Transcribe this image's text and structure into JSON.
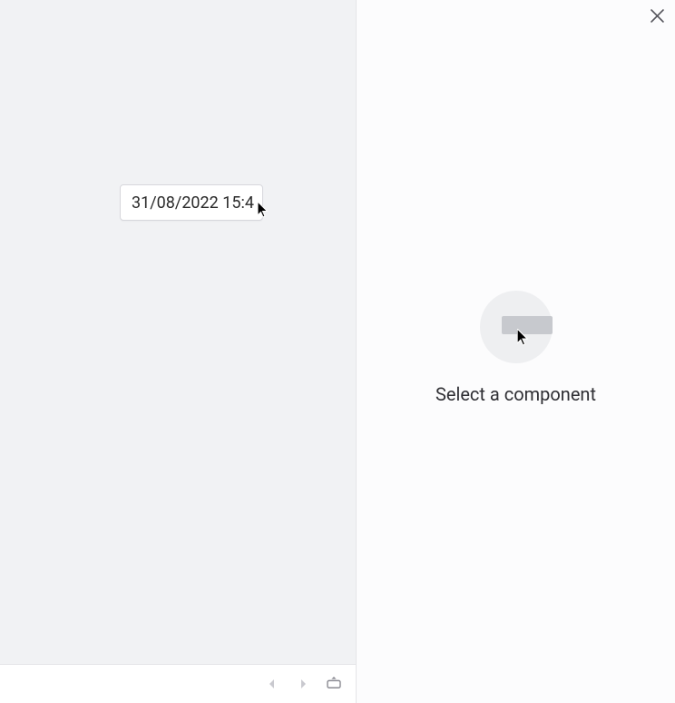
{
  "canvas": {
    "datetime_value": "31/08/2022 15:4"
  },
  "inspector": {
    "empty_message": "Select a component"
  }
}
